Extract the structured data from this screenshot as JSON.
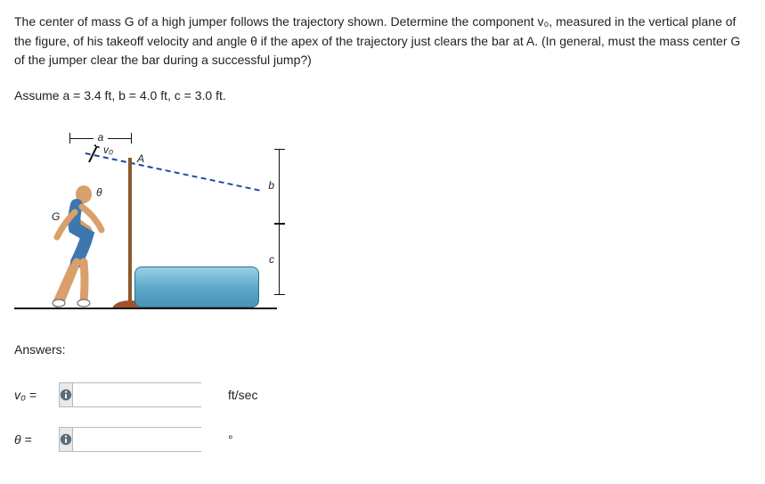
{
  "question": {
    "paragraph": "The center of mass G of a high jumper follows the trajectory shown. Determine the component v₀, measured in the vertical plane of the figure, of his takeoff velocity and angle θ if the apex of the trajectory just clears the bar at A. (In general, must the mass center G of the jumper clear the bar during a successful jump?)",
    "assume": "Assume a = 3.4 ft, b = 4.0 ft, c = 3.0 ft."
  },
  "figure": {
    "label_a": "a",
    "label_b": "b",
    "label_c": "c",
    "label_A": "A",
    "label_G": "G",
    "label_theta": "θ",
    "label_v0": "v₀"
  },
  "answers": {
    "heading": "Answers:",
    "rows": [
      {
        "label_html": "v₀ =",
        "value": "",
        "unit": "ft/sec"
      },
      {
        "label_html": "θ =",
        "value": "",
        "unit": "°"
      }
    ]
  }
}
